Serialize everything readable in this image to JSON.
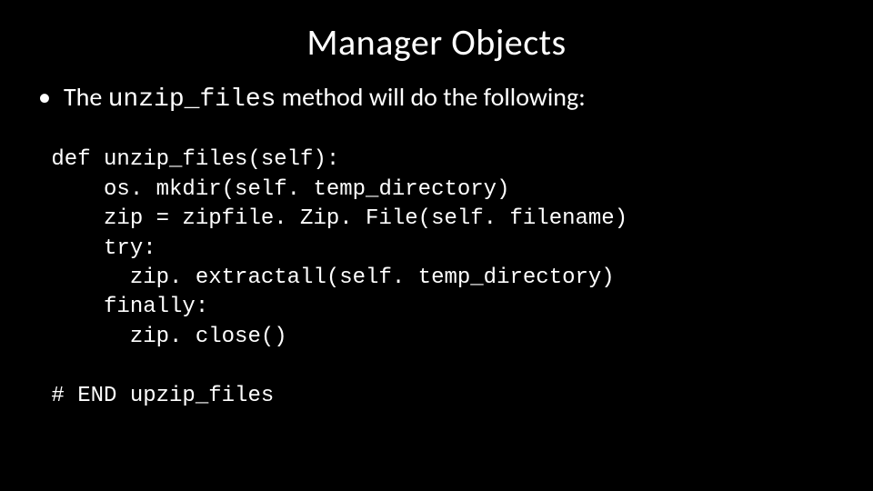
{
  "slide": {
    "title": "Manager Objects",
    "bullet": {
      "pre": "The ",
      "code": "unzip_files",
      "post": " method will do the following:"
    },
    "code": " def unzip_files(self):\n     os. mkdir(self. temp_directory)\n     zip = zipfile. Zip. File(self. filename)\n     try:\n       zip. extractall(self. temp_directory)\n     finally:\n       zip. close()\n\n # END upzip_files"
  }
}
